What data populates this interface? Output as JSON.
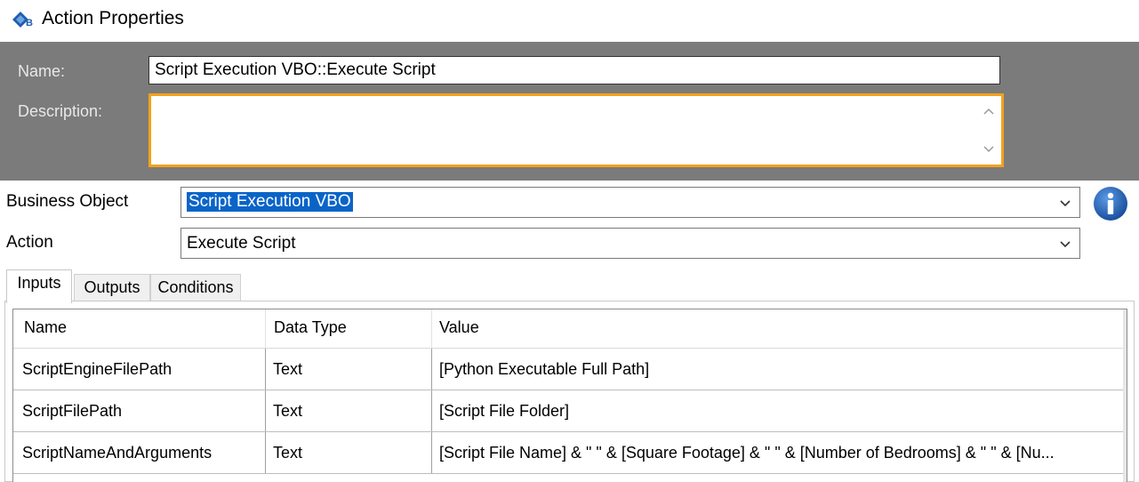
{
  "window": {
    "title": "Action Properties",
    "icon": "blue-prism-app-icon"
  },
  "header": {
    "name_label": "Name:",
    "name_value": "Script Execution VBO::Execute Script",
    "description_label": "Description:",
    "description_value": ""
  },
  "business_object": {
    "label": "Business Object",
    "value": "Script Execution VBO"
  },
  "action": {
    "label": "Action",
    "value": "Execute Script"
  },
  "tabs": [
    {
      "label": "Inputs",
      "active": true
    },
    {
      "label": "Outputs",
      "active": false
    },
    {
      "label": "Conditions",
      "active": false
    }
  ],
  "grid": {
    "columns": [
      "Name",
      "Data Type",
      "Value"
    ],
    "rows": [
      {
        "name": "ScriptEngineFilePath",
        "type": "Text",
        "value": "[Python Executable Full Path]"
      },
      {
        "name": "ScriptFilePath",
        "type": "Text",
        "value": "[Script File Folder]"
      },
      {
        "name": "ScriptNameAndArguments",
        "type": "Text",
        "value": "[Script File Name] & \" \" & [Square Footage] & \" \" & [Number of Bedrooms] & \" \" & [Nu..."
      }
    ]
  },
  "colors": {
    "header_panel": "#7b7b7b",
    "focus_border": "#f4a21a",
    "selection": "#0a64c8",
    "info_icon": "#1d5fb0"
  }
}
